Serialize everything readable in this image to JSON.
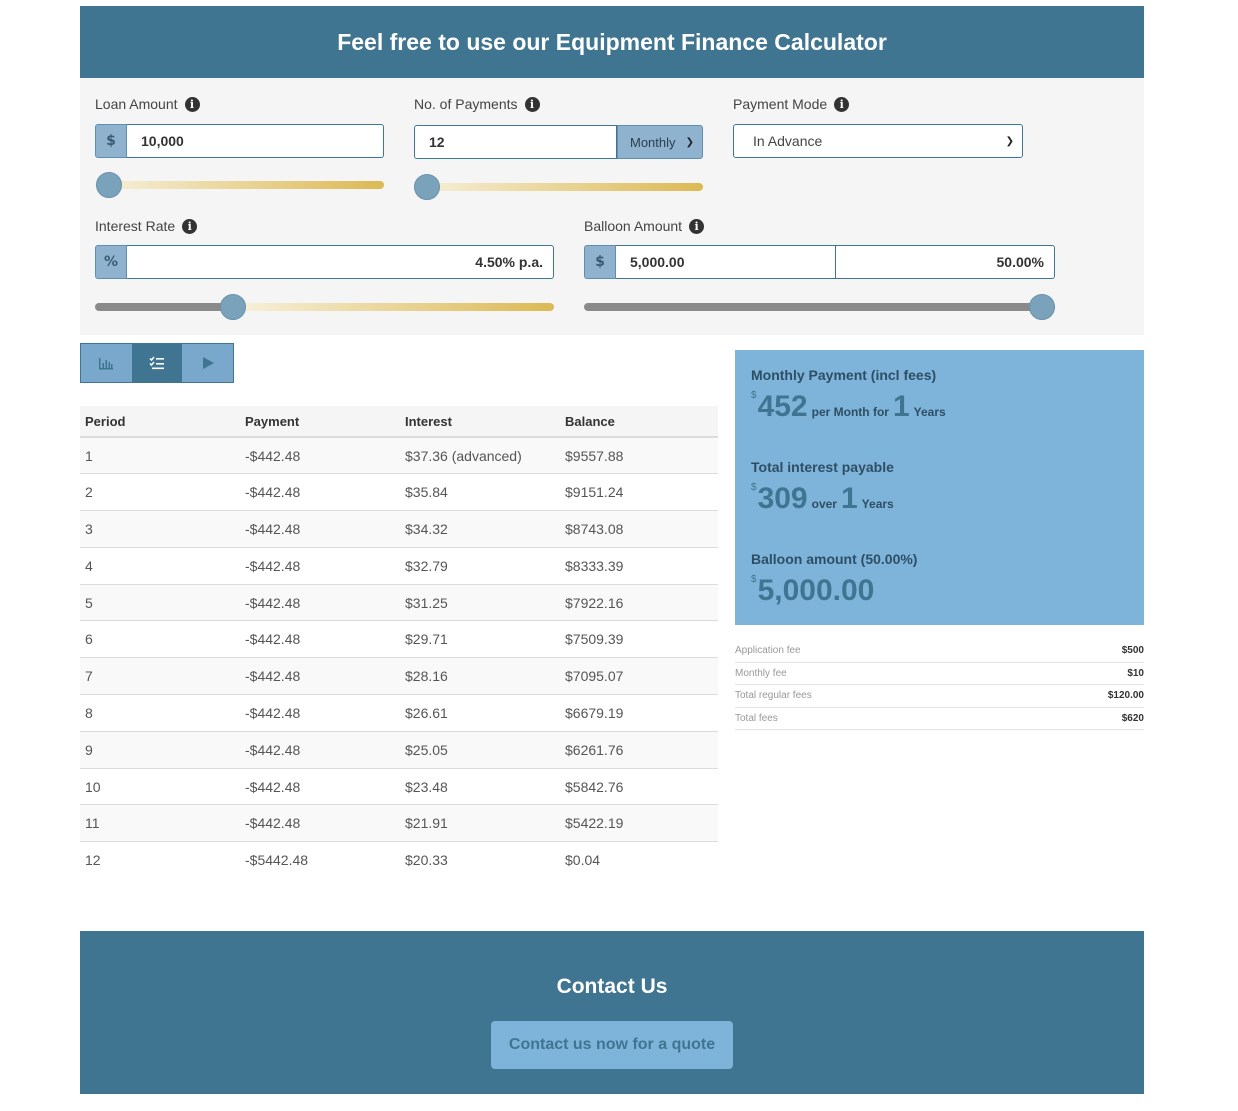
{
  "header": {
    "title": "Feel free to use our Equipment Finance Calculator"
  },
  "loan": {
    "label": "Loan Amount",
    "currency": "$",
    "value": "10,000",
    "slider_fraction": 0.0
  },
  "payments": {
    "label": "No. of Payments",
    "value": "12",
    "frequency": "Monthly",
    "slider_fraction": 0.0
  },
  "payment_mode": {
    "label": "Payment Mode",
    "value": "In Advance"
  },
  "interest": {
    "label": "Interest Rate",
    "unit": "%",
    "value": "4.50% p.a.",
    "slider_fraction": 0.3
  },
  "balloon": {
    "label": "Balloon Amount",
    "currency": "$",
    "amount": "5,000.00",
    "percent": "50.00%",
    "slider_fraction": 1.0
  },
  "tabs": [
    {
      "name": "chart",
      "icon": "bar-chart-icon",
      "active": false
    },
    {
      "name": "schedule",
      "icon": "list-check-icon",
      "active": true
    },
    {
      "name": "play",
      "icon": "play-icon",
      "active": false
    }
  ],
  "schedule": {
    "headers": [
      "Period",
      "Payment",
      "Interest",
      "Balance"
    ],
    "rows": [
      [
        "1",
        "-$442.48",
        "$37.36 (advanced)",
        "$9557.88"
      ],
      [
        "2",
        "-$442.48",
        "$35.84",
        "$9151.24"
      ],
      [
        "3",
        "-$442.48",
        "$34.32",
        "$8743.08"
      ],
      [
        "4",
        "-$442.48",
        "$32.79",
        "$8333.39"
      ],
      [
        "5",
        "-$442.48",
        "$31.25",
        "$7922.16"
      ],
      [
        "6",
        "-$442.48",
        "$29.71",
        "$7509.39"
      ],
      [
        "7",
        "-$442.48",
        "$28.16",
        "$7095.07"
      ],
      [
        "8",
        "-$442.48",
        "$26.61",
        "$6679.19"
      ],
      [
        "9",
        "-$442.48",
        "$25.05",
        "$6261.76"
      ],
      [
        "10",
        "-$442.48",
        "$23.48",
        "$5842.76"
      ],
      [
        "11",
        "-$442.48",
        "$21.91",
        "$5422.19"
      ],
      [
        "12",
        "-$5442.48",
        "$20.33",
        "$0.04"
      ]
    ]
  },
  "summary": {
    "monthly_label": "Monthly Payment (incl fees)",
    "monthly_currency": "$",
    "monthly_value": "452",
    "monthly_per": "per Month for",
    "monthly_years": "1",
    "monthly_years_label": "Years",
    "interest_label": "Total interest payable",
    "interest_currency": "$",
    "interest_value": "309",
    "interest_over": "over",
    "interest_years": "1",
    "interest_years_label": "Years",
    "balloon_label": "Balloon amount (50.00%)",
    "balloon_currency": "$",
    "balloon_value": "5,000.00"
  },
  "fees": [
    {
      "label": "Application fee",
      "value": "$500"
    },
    {
      "label": "Monthly fee",
      "value": "$10"
    },
    {
      "label": "Total regular fees",
      "value": "$120.00"
    },
    {
      "label": "Total fees",
      "value": "$620"
    }
  ],
  "contact": {
    "title": "Contact Us",
    "button": "Contact us now for a quote"
  },
  "colors": {
    "primary": "#3f7591",
    "accent": "#7fb4da",
    "gold": "#dcb954",
    "panel": "#f5f5f5"
  }
}
